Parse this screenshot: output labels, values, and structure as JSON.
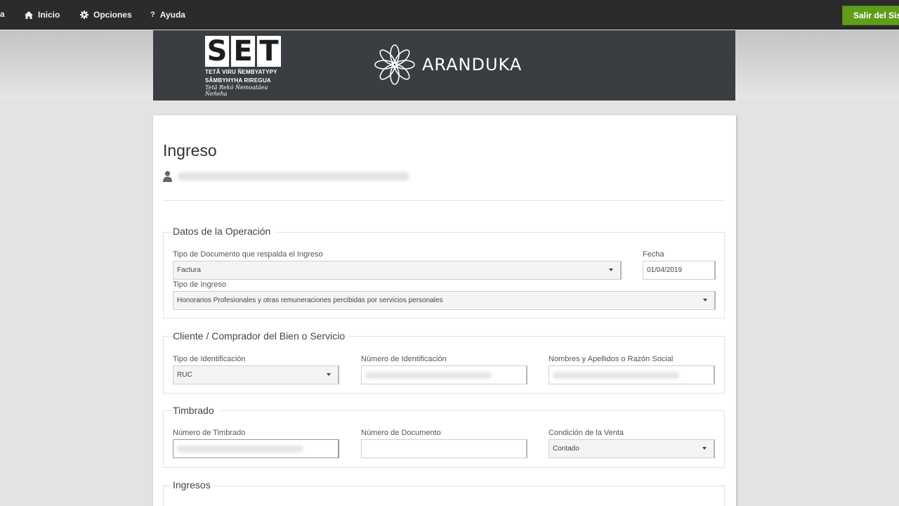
{
  "nav": {
    "items": [
      {
        "label": "Inicio",
        "icon": "home-icon"
      },
      {
        "label": "Opciones",
        "icon": "gear-icon"
      },
      {
        "label": "Ayuda",
        "icon": "question-icon"
      }
    ],
    "exit_label": "Salir del Sis"
  },
  "header": {
    "set_letters": [
      "S",
      "E",
      "T"
    ],
    "set_line1": "TETÃ VIRU ÑEMBYATYPY",
    "set_line2": "SÃMBYHYHA RIREGUA",
    "set_script": "Tetã Rekó Ñemoatãea Ñeñeha",
    "product_name": "ARANDUKA"
  },
  "page": {
    "title": "Ingreso"
  },
  "operacion": {
    "legend": "Datos de la Operación",
    "tipo_documento_label": "Tipo de Documento que respalda el Ingreso",
    "tipo_documento_value": "Factura",
    "fecha_label": "Fecha",
    "fecha_value": "01/04/2019",
    "tipo_ingreso_label": "Tipo de Ingreso",
    "tipo_ingreso_value": "Honorarios Profesionales y otras remuneraciones percibidas por servicios personales"
  },
  "cliente": {
    "legend": "Cliente / Comprador del Bien o Servicio",
    "tipo_id_label": "Tipo de Identificación",
    "tipo_id_value": "RUC",
    "numero_id_label": "Número de Identificación",
    "nombre_label": "Nombres y Apellidos o Razón Social"
  },
  "timbrado": {
    "legend": "Timbrado",
    "numero_timbrado_label": "Número de Timbrado",
    "numero_documento_label": "Número de Documento",
    "condicion_label": "Condición de la Venta",
    "condicion_value": "Contado"
  },
  "ingresos": {
    "legend": "Ingresos"
  },
  "colors": {
    "nav_bg": "#2b2b2b",
    "header_bg": "#3a3d42",
    "exit_button": "#5f9e1a"
  }
}
